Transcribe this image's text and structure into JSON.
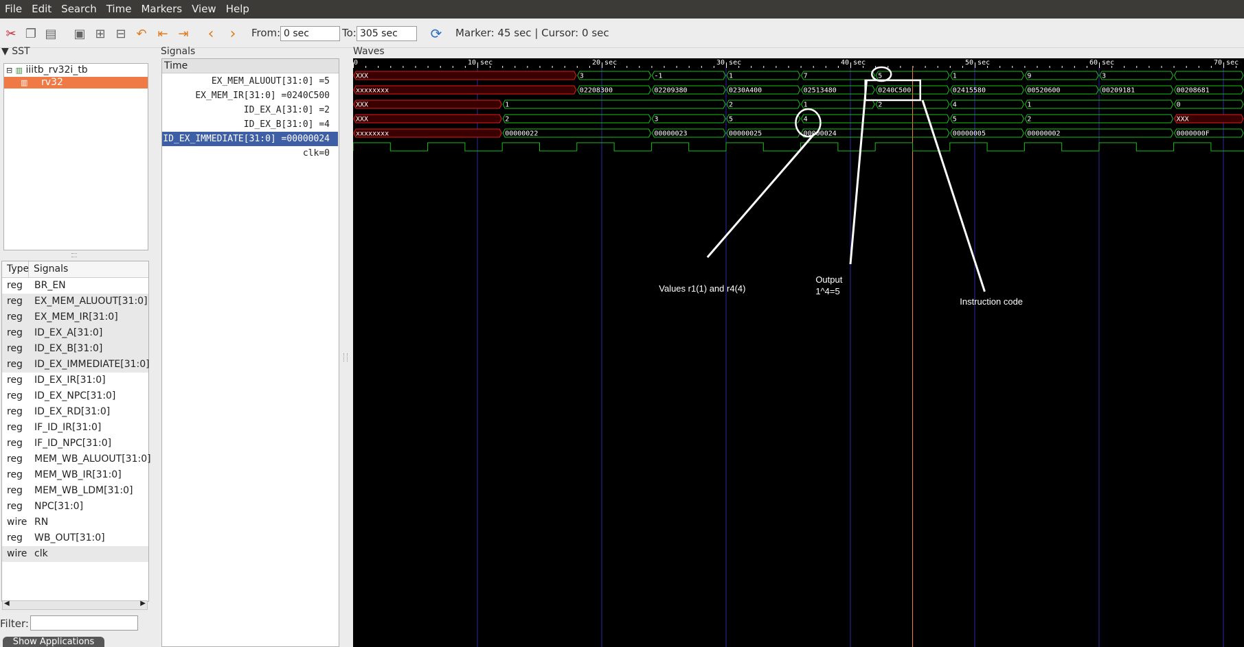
{
  "menu": [
    "File",
    "Edit",
    "Search",
    "Time",
    "Markers",
    "View",
    "Help"
  ],
  "toolbar": {
    "icons": [
      "cut-icon",
      "copy-icon",
      "paste-icon",
      "zoom-fit-icon",
      "zoom-in-icon",
      "zoom-out-icon",
      "undo-zoom-icon",
      "zoom-begin-icon",
      "zoom-end-icon",
      "prev-edge-icon",
      "next-edge-icon"
    ],
    "from_label": "From:",
    "from_value": "0 sec",
    "to_label": "To:",
    "to_value": "305 sec",
    "reload_icon": "reload-icon",
    "status": "Marker: 45 sec  |  Cursor: 0 sec"
  },
  "sst": {
    "title": "SST",
    "tree": [
      {
        "label": "iiitb_rv32i_tb",
        "icon": "module-icon"
      },
      {
        "label": "rv32",
        "icon": "module-icon",
        "selected": true
      }
    ],
    "columns": {
      "type": "Type",
      "signals": "Signals"
    },
    "signals": [
      {
        "type": "reg",
        "name": "BR_EN"
      },
      {
        "type": "reg",
        "name": "EX_MEM_ALUOUT[31:0]"
      },
      {
        "type": "reg",
        "name": "EX_MEM_IR[31:0]"
      },
      {
        "type": "reg",
        "name": "ID_EX_A[31:0]"
      },
      {
        "type": "reg",
        "name": "ID_EX_B[31:0]"
      },
      {
        "type": "reg",
        "name": "ID_EX_IMMEDIATE[31:0]"
      },
      {
        "type": "reg",
        "name": "ID_EX_IR[31:0]"
      },
      {
        "type": "reg",
        "name": "ID_EX_NPC[31:0]"
      },
      {
        "type": "reg",
        "name": "ID_EX_RD[31:0]"
      },
      {
        "type": "reg",
        "name": "IF_ID_IR[31:0]"
      },
      {
        "type": "reg",
        "name": "IF_ID_NPC[31:0]"
      },
      {
        "type": "reg",
        "name": "MEM_WB_ALUOUT[31:0]"
      },
      {
        "type": "reg",
        "name": "MEM_WB_IR[31:0]"
      },
      {
        "type": "reg",
        "name": "MEM_WB_LDM[31:0]"
      },
      {
        "type": "reg",
        "name": "NPC[31:0]"
      },
      {
        "type": "wire",
        "name": "RN"
      },
      {
        "type": "reg",
        "name": "WB_OUT[31:0]"
      },
      {
        "type": "wire",
        "name": "clk"
      }
    ],
    "filter_label": "Filter:",
    "filter_value": "",
    "show_apps": "Show Applications"
  },
  "signals_panel": {
    "title": "Signals",
    "header": "Time",
    "rows": [
      {
        "label": "EX_MEM_ALUOUT[31:0] =5"
      },
      {
        "label": "EX_MEM_IR[31:0] =0240C500"
      },
      {
        "label": "ID_EX_A[31:0] =2"
      },
      {
        "label": "ID_EX_B[31:0] =4"
      },
      {
        "label": "ID_EX_IMMEDIATE[31:0] =00000024",
        "selected": true
      },
      {
        "label": "clk=0"
      }
    ]
  },
  "waves": {
    "title": "Waves",
    "time_labels": [
      "0",
      "10 sec",
      "20 sec",
      "30 sec",
      "40 sec",
      "50 sec",
      "60 sec",
      "70 sec"
    ],
    "time_ticks": [
      0,
      10,
      20,
      30,
      40,
      50,
      60,
      70
    ],
    "period": 6,
    "marker_time": 45,
    "colors": {
      "valid": "#19c019",
      "undefined": "#e01b1b",
      "marker": "#ff7a3a",
      "grid": "#2a2aa8",
      "background": "#000000"
    },
    "traces": [
      {
        "segments": [
          [
            0,
            18,
            "XXX"
          ],
          [
            18,
            24,
            "3"
          ],
          [
            24,
            30,
            "-1"
          ],
          [
            30,
            36,
            "1"
          ],
          [
            36,
            42,
            "7"
          ],
          [
            42,
            48,
            "5"
          ],
          [
            48,
            54,
            "1"
          ],
          [
            54,
            60,
            "9"
          ],
          [
            60,
            66,
            "3"
          ],
          [
            66,
            80,
            ""
          ]
        ]
      },
      {
        "segments": [
          [
            0,
            18,
            "xxxxxxxx"
          ],
          [
            18,
            24,
            "02208300"
          ],
          [
            24,
            30,
            "02209380"
          ],
          [
            30,
            36,
            "0230A400"
          ],
          [
            36,
            42,
            "02513480"
          ],
          [
            42,
            48,
            "0240C500"
          ],
          [
            48,
            54,
            "02415580"
          ],
          [
            54,
            60,
            "00520600"
          ],
          [
            60,
            66,
            "00209181"
          ],
          [
            66,
            80,
            "00208681"
          ]
        ]
      },
      {
        "segments": [
          [
            0,
            12,
            "XXX"
          ],
          [
            12,
            30,
            "1"
          ],
          [
            30,
            36,
            "2"
          ],
          [
            36,
            42,
            "1"
          ],
          [
            42,
            48,
            "2"
          ],
          [
            48,
            54,
            "4"
          ],
          [
            54,
            66,
            "1"
          ],
          [
            66,
            80,
            "0"
          ]
        ]
      },
      {
        "segments": [
          [
            0,
            12,
            "XXX"
          ],
          [
            12,
            24,
            "2"
          ],
          [
            24,
            30,
            "3"
          ],
          [
            30,
            36,
            "5"
          ],
          [
            36,
            48,
            "4"
          ],
          [
            48,
            54,
            "5"
          ],
          [
            54,
            66,
            "2"
          ],
          [
            66,
            80,
            "XXX"
          ]
        ]
      },
      {
        "segments": [
          [
            0,
            12,
            "xxxxxxxx"
          ],
          [
            12,
            24,
            "00000022"
          ],
          [
            24,
            30,
            "00000023"
          ],
          [
            30,
            36,
            "00000025"
          ],
          [
            36,
            48,
            "00000024"
          ],
          [
            48,
            54,
            "00000005"
          ],
          [
            54,
            66,
            "00000002"
          ],
          [
            66,
            80,
            "0000000F"
          ]
        ]
      }
    ],
    "annotations": [
      {
        "text": "Values r1(1) and r4(4)"
      },
      {
        "text": "Output"
      },
      {
        "text": "1^4=5"
      },
      {
        "text": "Instruction code"
      }
    ]
  }
}
